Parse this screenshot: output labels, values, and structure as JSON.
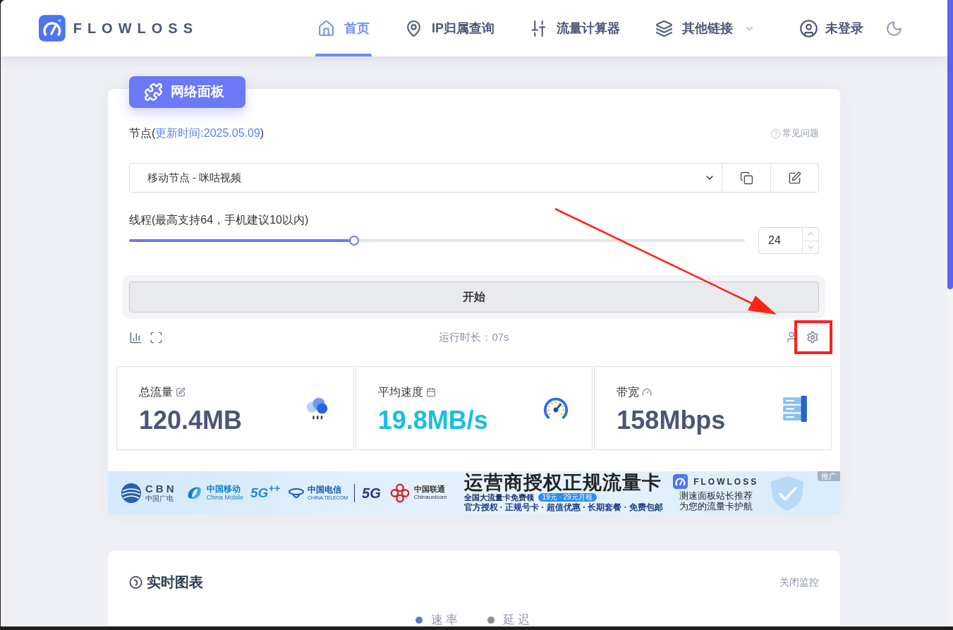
{
  "header": {
    "logo_text": "FLOWLOSS",
    "nav": [
      {
        "kind": "home",
        "label": "首页",
        "selected": true,
        "dropdown": false
      },
      {
        "kind": "pin",
        "label": "IP归属查询",
        "selected": false,
        "dropdown": false
      },
      {
        "kind": "sliders",
        "label": "流量计算器",
        "selected": false,
        "dropdown": false
      },
      {
        "kind": "layers",
        "label": "其他链接",
        "selected": false,
        "dropdown": true
      }
    ],
    "user_label": "未登录"
  },
  "panel": {
    "badge": "网络面板",
    "node_label": "节点(",
    "node_updated": "更新时间:2025.05.09",
    "node_label_end": ")",
    "faq": "常见问题",
    "node_select": {
      "value": "移动节点 - 咪咕视频"
    },
    "threads": {
      "label": "线程(最高支持64，手机建议10以内)",
      "level": 0.365,
      "value": "24"
    },
    "start_button": "开始",
    "runtime": "运行时长：07s",
    "stats": [
      {
        "kind": "traffic",
        "label": "总流量",
        "value": "120.4MB",
        "color": "#4b5675"
      },
      {
        "kind": "speed",
        "label": "平均速度",
        "value": "19.8MB/s",
        "color": "#1bbde0"
      },
      {
        "kind": "bandwidth",
        "label": "带宽",
        "value": "158Mbps",
        "color": "#4b5675"
      }
    ]
  },
  "banner": {
    "partners": [
      {
        "kind": "cbn",
        "top": "CBN",
        "bottom": "中国广电"
      },
      {
        "kind": "mobile",
        "top": "中国移动",
        "bottom": "China Mobile"
      },
      {
        "kind": "fiveg",
        "top": "5G$^{++}$"
      },
      {
        "kind": "telecom",
        "top": "中国电信",
        "bottom": "CHINA TELECOM"
      },
      {
        "kind": "fivegbold",
        "top": "5G"
      },
      {
        "kind": "unicom",
        "top": "中国联通",
        "bottom": "Chinaunicom"
      }
    ],
    "headline": "运营商授权正规流量卡",
    "offer": "全国大流量卡免费领",
    "price_tag": "19元 · 29元月租",
    "features": "官方授权 · 正规号卡 · 超值优惠 · 长期套餐 · 免费包邮",
    "brand": "FLOWLOSS",
    "slogan_1": "测速面板站长推荐",
    "slogan_2": "为您的流量卡护航",
    "ad_tag": "推广"
  },
  "chart_panel": {
    "title": "实时图表",
    "toggle": "关闭监控",
    "legend": [
      {
        "label": "速率",
        "color": "#4f7ec6"
      },
      {
        "label": "延迟",
        "color": "#8c8c8c"
      }
    ]
  }
}
